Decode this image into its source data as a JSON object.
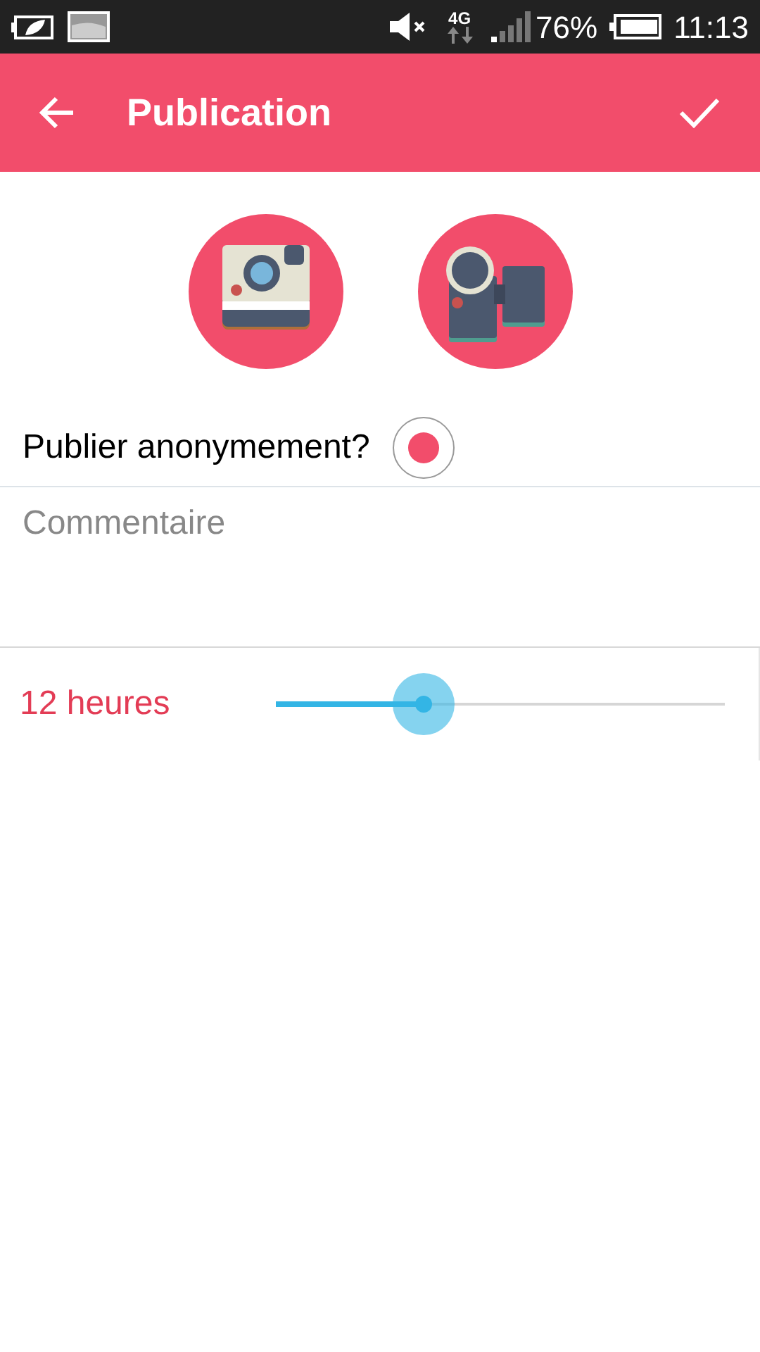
{
  "status_bar": {
    "battery_text": "76%",
    "time": "11:13",
    "network": "4G"
  },
  "app_bar": {
    "title": "Publication"
  },
  "media_buttons": [
    {
      "kind": "photo"
    },
    {
      "kind": "video"
    }
  ],
  "anonymous": {
    "label": "Publier anonymement?",
    "checked": true
  },
  "comment": {
    "placeholder": "Commentaire"
  },
  "duration": {
    "reading": "12 heures",
    "level": 0.33
  }
}
